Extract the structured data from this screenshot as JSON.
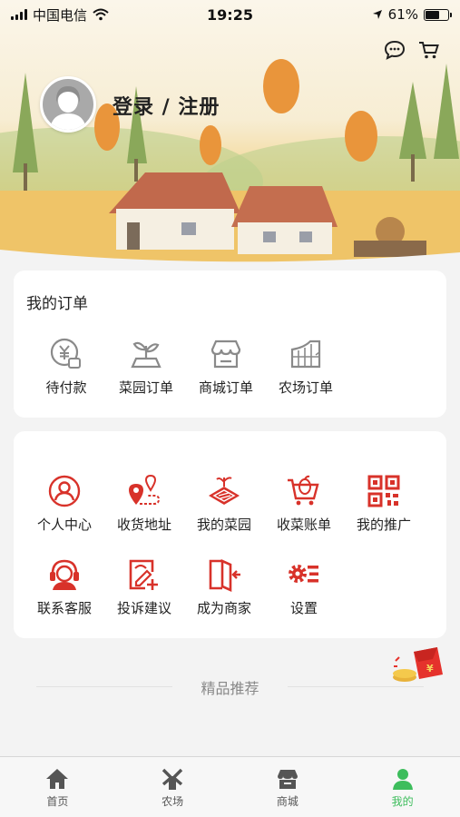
{
  "status_bar": {
    "carrier": "中国电信",
    "time": "19:25",
    "battery": "61%",
    "battery_level": 0.61
  },
  "header": {
    "login_label": "登录 / 注册",
    "icons": [
      "chat-bubble-icon",
      "cart-icon"
    ]
  },
  "orders": {
    "title": "我的订单",
    "items": [
      {
        "label": "待付款",
        "icon": "payment-icon"
      },
      {
        "label": "菜园订单",
        "icon": "garden-order-icon"
      },
      {
        "label": "商城订单",
        "icon": "store-order-icon"
      },
      {
        "label": "农场订单",
        "icon": "farm-order-icon"
      }
    ]
  },
  "services": {
    "items": [
      {
        "label": "个人中心",
        "icon": "user-icon"
      },
      {
        "label": "收货地址",
        "icon": "address-icon"
      },
      {
        "label": "我的菜园",
        "icon": "garden-icon"
      },
      {
        "label": "收菜账单",
        "icon": "harvest-cart-icon"
      },
      {
        "label": "我的推广",
        "icon": "qrcode-icon"
      },
      {
        "label": "联系客服",
        "icon": "customer-service-icon"
      },
      {
        "label": "投诉建议",
        "icon": "feedback-icon"
      },
      {
        "label": "成为商家",
        "icon": "merchant-icon"
      },
      {
        "label": "设置",
        "icon": "settings-icon"
      }
    ]
  },
  "recommend_title": "精品推荐",
  "tabbar": {
    "tabs": [
      {
        "label": "首页",
        "icon": "home-icon"
      },
      {
        "label": "农场",
        "icon": "windmill-icon"
      },
      {
        "label": "商城",
        "icon": "store-icon"
      },
      {
        "label": "我的",
        "icon": "profile-icon"
      }
    ],
    "active": "我的"
  },
  "colors": {
    "accent_red": "#d8322a",
    "tab_active": "#3dbd5c",
    "icon_gray": "#8a8a8a"
  }
}
